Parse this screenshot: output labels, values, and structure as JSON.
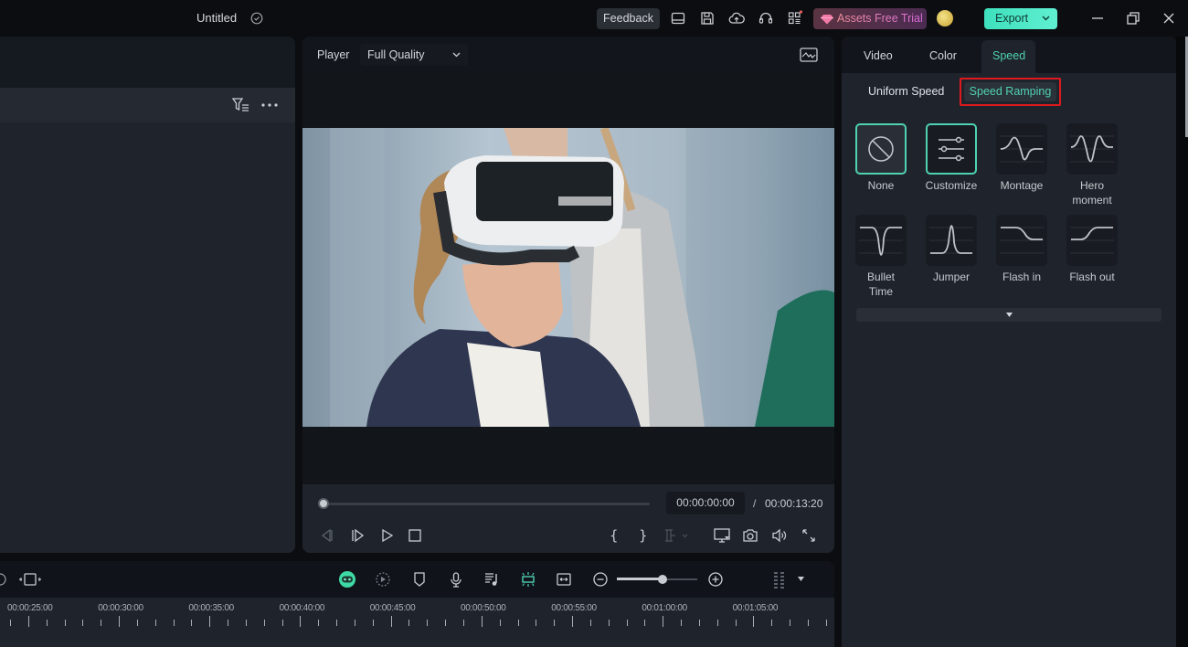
{
  "titlebar": {
    "project_title": "Untitled",
    "feedback_label": "Feedback",
    "assets_label": "Assets Free Trial",
    "export_label": "Export",
    "icons": [
      "layout-icon",
      "save-icon",
      "cloud-upload-icon",
      "headset-icon",
      "apps-grid-icon"
    ]
  },
  "player": {
    "label": "Player",
    "quality": "Full Quality",
    "current_time": "00:00:00:00",
    "separator": "/",
    "total_time": "00:00:13:20",
    "progress": 0
  },
  "right_panel": {
    "tabs": [
      {
        "label": "Video",
        "active": false
      },
      {
        "label": "Color",
        "active": false
      },
      {
        "label": "Speed",
        "active": true
      }
    ],
    "subtabs": {
      "uniform": "Uniform Speed",
      "ramping": "Speed Ramping",
      "selected": "Speed Ramping"
    },
    "presets": [
      {
        "label": "None",
        "selected": true
      },
      {
        "label": "Customize",
        "selected": false
      },
      {
        "label": "Montage",
        "selected": false
      },
      {
        "label": "Hero moment",
        "selected": false
      },
      {
        "label": "Bullet Time",
        "selected": false
      },
      {
        "label": "Jumper",
        "selected": false
      },
      {
        "label": "Flash in",
        "selected": false
      },
      {
        "label": "Flash out",
        "selected": false
      }
    ]
  },
  "timeline": {
    "zoom_level": 0.57,
    "ruler_labels": [
      "00:00:25:00",
      "00:00:30:00",
      "00:00:35:00",
      "00:00:40:00",
      "00:00:45:00",
      "00:00:50:00",
      "00:00:55:00",
      "00:01:00:00",
      "00:01:05:00"
    ]
  },
  "colors": {
    "accent": "#4fd1b3",
    "highlight_box": "#e0191f",
    "export_bg": "#3ee0bd"
  }
}
